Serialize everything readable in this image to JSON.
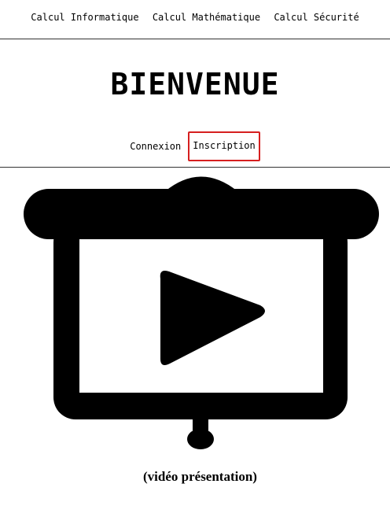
{
  "top_nav": {
    "items": [
      {
        "label": "Calcul Informatique"
      },
      {
        "label": "Calcul Mathématique"
      },
      {
        "label": "Calcul Sécurité"
      }
    ]
  },
  "header": {
    "title": "BIENVENUE"
  },
  "auth_nav": {
    "login_label": "Connexion",
    "register_label": "Inscription",
    "highlight_color": "#d61f1f"
  },
  "media": {
    "icon": "projector-screen-play-icon",
    "caption": "(vidéo présentation)"
  }
}
